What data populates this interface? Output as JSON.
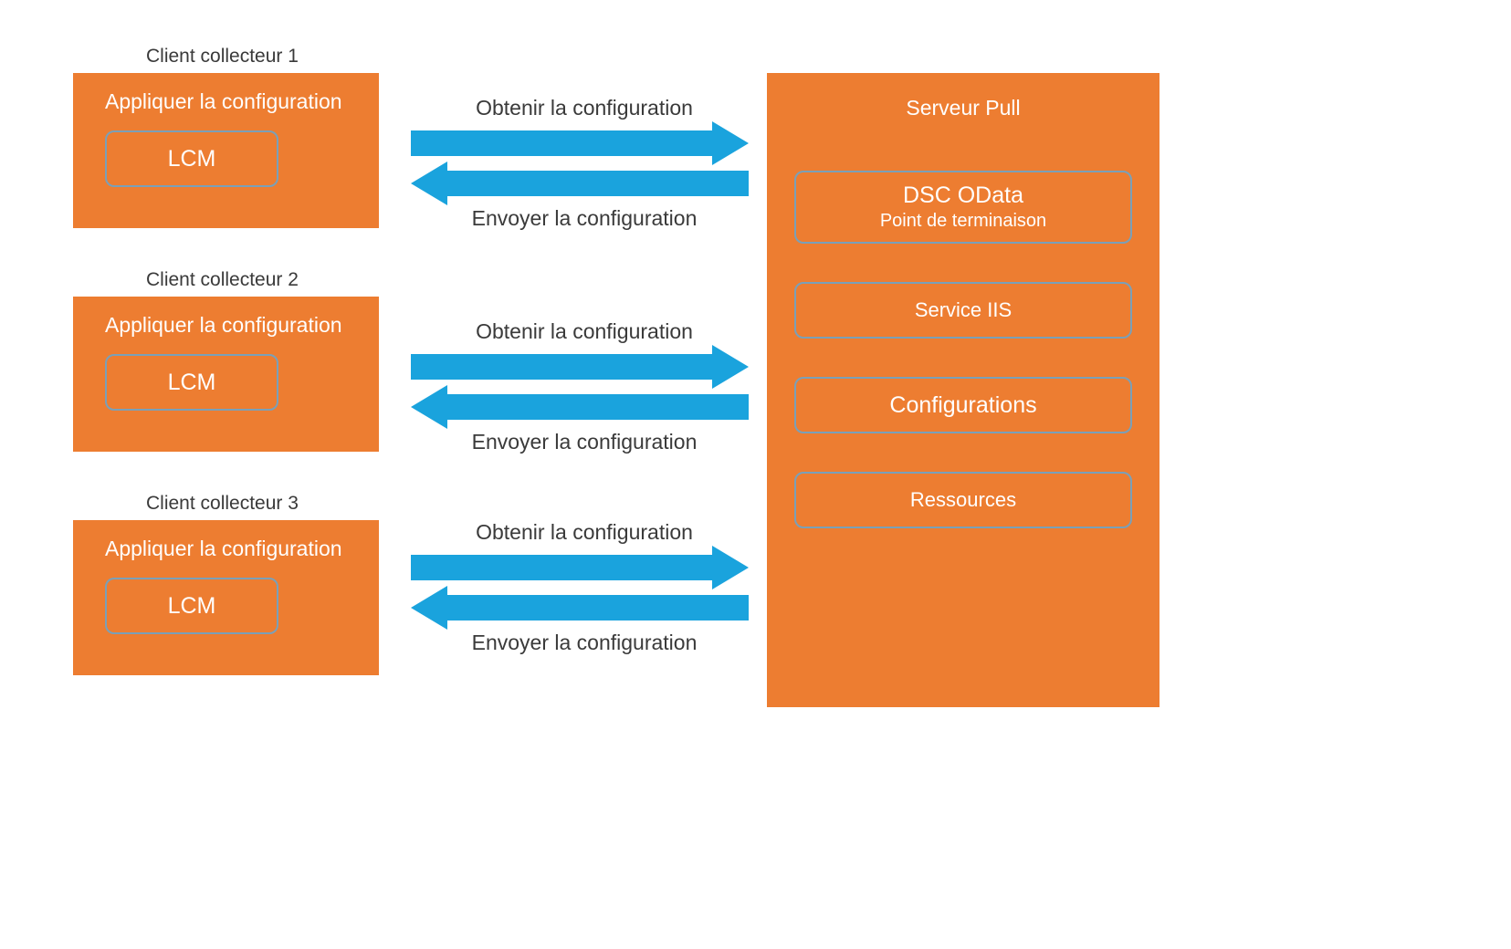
{
  "clients": [
    {
      "label": "Client collecteur 1",
      "apply": "Appliquer la configuration",
      "lcm": "LCM"
    },
    {
      "label": "Client collecteur 2",
      "apply": "Appliquer la configuration",
      "lcm": "LCM"
    },
    {
      "label": "Client collecteur 3",
      "apply": "Appliquer la configuration",
      "lcm": "LCM"
    }
  ],
  "arrows": {
    "get": "Obtenir la configuration",
    "send": "Envoyer la configuration"
  },
  "server": {
    "title": "Serveur Pull",
    "odata_line1": "DSC OData",
    "odata_line2": "Point de terminaison",
    "iis": "Service IIS",
    "configs": "Configurations",
    "resources": "Ressources"
  },
  "colors": {
    "orange": "#ed7d31",
    "blue": "#1aa3dd",
    "border": "#7aa0b8"
  }
}
